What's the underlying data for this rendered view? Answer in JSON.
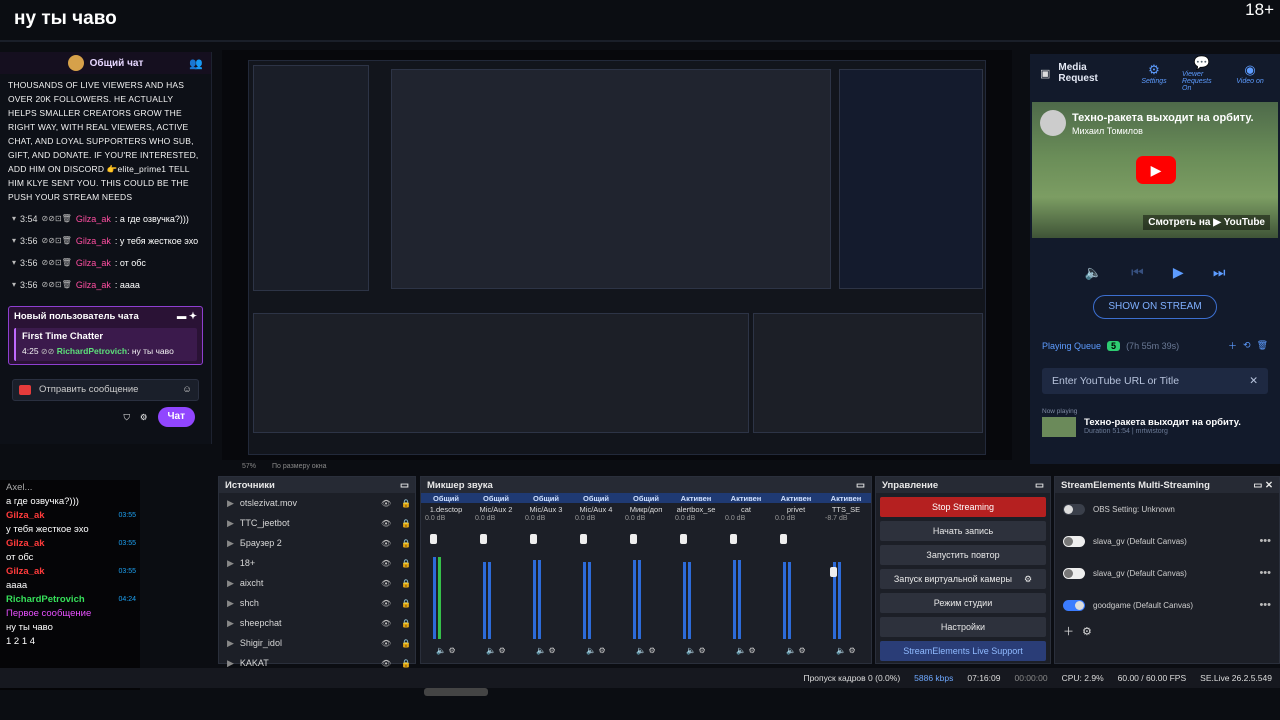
{
  "stream": {
    "title": "ну ты чаво",
    "age": "18+"
  },
  "chat": {
    "header": "Общий чат",
    "system_text": "THOUSANDS OF LIVE VIEWERS AND HAS OVER 20K FOLLOWERS. HE ACTUALLY HELPS SMALLER CREATORS GROW THE RIGHT WAY, WITH REAL VIEWERS, ACTIVE CHAT, AND LOYAL SUPPORTERS WHO SUB, GIFT, AND DONATE. IF YOU'RE INTERESTED, ADD HIM ON DISCORD 👉elite_prime1 TELL HIM KLYE SENT YOU. THIS COULD BE THE PUSH YOUR STREAM NEEDS",
    "messages": [
      {
        "time": "3:54",
        "user": "Gilza_ak",
        "text": ": а где озвучка?)))"
      },
      {
        "time": "3:56",
        "user": "Gilza_ak",
        "text": ": у тебя жесткое эхо"
      },
      {
        "time": "3:56",
        "user": "Gilza_ak",
        "text": ": от обс"
      },
      {
        "time": "3:56",
        "user": "Gilza_ak",
        "text": ": аааа"
      }
    ],
    "new_user": {
      "title": "Новый пользователь чата",
      "badge": "First Time Chatter",
      "time": "4:25",
      "user": "RichardPetrovich",
      "text": ": ну ты чаво"
    },
    "send_placeholder": "Отправить сообщение",
    "chat_button": "Чат"
  },
  "preview": {
    "zoom": "57%",
    "fit_label": "По размеру окна"
  },
  "media": {
    "title": "Media Request",
    "buttons": [
      {
        "icon": "gear",
        "label": "Settings"
      },
      {
        "icon": "chat",
        "label": "Viewer Requests On"
      },
      {
        "icon": "broadcast",
        "label": "Video on"
      }
    ],
    "video_title": "Техно-ракета выходит на орбиту.",
    "channel": "Михаил Томилов",
    "watch_on": "Смотреть на ▶ YouTube",
    "show_on_stream": "SHOW ON STREAM",
    "queue_label": "Playing Queue",
    "queue_count": "5",
    "queue_duration": "(7h 55m 39s)",
    "url_placeholder": "Enter YouTube URL or Title",
    "now_playing": "Now playing",
    "np_title": "Техно-ракета выходит на орбиту.",
    "np_meta": "Duration 51:54 | mrtwistorg"
  },
  "chat2": {
    "header": "Axel...",
    "rows": [
      {
        "text": "а где озвучка?)))",
        "kind": "text"
      },
      {
        "user": "Gilza_ak",
        "time": "03:55",
        "kind": "user"
      },
      {
        "text": "у тебя жесткое эхо",
        "kind": "text"
      },
      {
        "user": "Gilza_ak",
        "time": "03:55",
        "kind": "user"
      },
      {
        "text": "от обс",
        "kind": "text"
      },
      {
        "user": "Gilza_ak",
        "time": "03:55",
        "kind": "user"
      },
      {
        "text": "аааа",
        "kind": "text"
      },
      {
        "user": "RichardPetrovich",
        "time": "04:24",
        "kind": "user"
      },
      {
        "text": "Первое сообщение",
        "kind": "first"
      },
      {
        "text": "ну ты чаво",
        "kind": "text"
      }
    ],
    "footer": "1  2  1  4"
  },
  "sources": {
    "title": "Источники",
    "items": [
      "otslezivat.mov",
      "TTC_jeetbot",
      "Браузер 2",
      "18+",
      "aixcht",
      "shch",
      "sheepchat",
      "Shigir_idol",
      "KAKAT"
    ]
  },
  "mixer": {
    "title": "Микшер звука",
    "channels": [
      {
        "status": "Общий",
        "name": "1.desctop",
        "db": "0.0 dB",
        "level": 0.75,
        "fader": 0.9,
        "green": true
      },
      {
        "status": "Общий",
        "name": "Mic/Aux 2",
        "db": "0.0 dB",
        "level": 0.7,
        "fader": 0.9,
        "green": false
      },
      {
        "status": "Общий",
        "name": "Mic/Aux 3",
        "db": "0.0 dB",
        "level": 0.72,
        "fader": 0.9,
        "green": false
      },
      {
        "status": "Общий",
        "name": "Mic/Aux 4",
        "db": "0.0 dB",
        "level": 0.7,
        "fader": 0.9,
        "green": false
      },
      {
        "status": "Общий",
        "name": "Микр/доп",
        "db": "0.0 dB",
        "level": 0.72,
        "fader": 0.9,
        "green": false
      },
      {
        "status": "Активен",
        "name": "alertbox_se",
        "db": "0.0 dB",
        "level": 0.7,
        "fader": 0.9,
        "green": false
      },
      {
        "status": "Активен",
        "name": "cat",
        "db": "0.0 dB",
        "level": 0.72,
        "fader": 0.9,
        "green": false
      },
      {
        "status": "Активен",
        "name": "privet",
        "db": "0.0 dB",
        "level": 0.7,
        "fader": 0.9,
        "green": false
      },
      {
        "status": "Активен",
        "name": "TTS_SE",
        "db": "-8.7 dB",
        "level": 0.7,
        "fader": 0.6,
        "green": false
      }
    ]
  },
  "control": {
    "title": "Управление",
    "buttons": [
      "Stop Streaming",
      "Начать запись",
      "Запустить повтор",
      "Запуск виртуальной камеры",
      "Режим студии",
      "Настройки",
      "StreamElements Live Support"
    ]
  },
  "se": {
    "title": "StreamElements Multi-Streaming",
    "rows": [
      {
        "label": "OBS Setting: Unknown",
        "toggle": "none"
      },
      {
        "label": "slava_gv (Default Canvas)",
        "toggle": "off"
      },
      {
        "label": "slava_gv (Default Canvas)",
        "toggle": "off"
      },
      {
        "label": "goodgame (Default Canvas)",
        "toggle": "on"
      }
    ]
  },
  "status": {
    "dropped": "Пропуск кадров 0 (0.0%)",
    "bitrate": "5886 kbps",
    "time": "07:16:09",
    "rec": "00:00:00",
    "cpu": "CPU: 2.9%",
    "fps": "60.00 / 60.00 FPS",
    "version": "SE.Live 26.2.5.549"
  }
}
